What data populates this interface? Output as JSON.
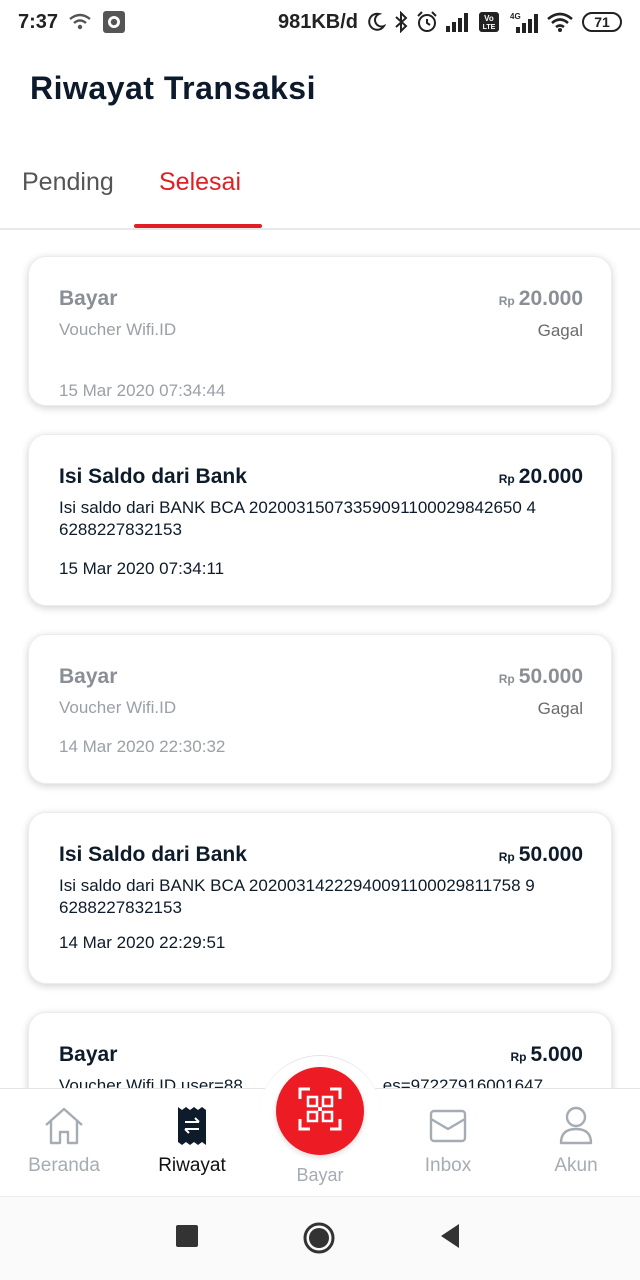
{
  "status_bar": {
    "time": "7:37",
    "network_speed": "981KB/d",
    "battery": "71",
    "volte": "Vo LTE",
    "signal_label": "4G"
  },
  "header": {
    "title": "Riwayat Transaksi"
  },
  "tabs": [
    {
      "label": "Pending",
      "active": false
    },
    {
      "label": "Selesai",
      "active": true
    }
  ],
  "transactions": [
    {
      "title": "Bayar",
      "currency": "Rp",
      "amount": "20.000",
      "description": "Voucher Wifi.ID",
      "status": "Gagal",
      "date": "15 Mar 2020 07:34:44"
    },
    {
      "title": "Isi Saldo dari Bank",
      "currency": "Rp",
      "amount": "20.000",
      "description": "Isi saldo dari BANK BCA 20200315073359091100029842650 4 6288227832153",
      "status": "",
      "date": "15 Mar 2020 07:34:11"
    },
    {
      "title": "Bayar",
      "currency": "Rp",
      "amount": "50.000",
      "description": "Voucher Wifi.ID",
      "status": "Gagal",
      "date": "14 Mar 2020 22:30:32"
    },
    {
      "title": "Isi Saldo dari Bank",
      "currency": "Rp",
      "amount": "50.000",
      "description": "Isi saldo dari BANK BCA 20200314222940091100029811758 9 6288227832153",
      "status": "",
      "date": "14 Mar 2020 22:29:51"
    },
    {
      "title": "Bayar",
      "currency": "Rp",
      "amount": "5.000",
      "description": "Voucher Wifi.ID user=88",
      "description_tail": "es=97227916001647",
      "status": "",
      "date": ""
    }
  ],
  "bottom_nav": {
    "items": [
      {
        "label": "Beranda",
        "icon": "home-icon"
      },
      {
        "label": "Riwayat",
        "icon": "receipt-icon"
      },
      {
        "label": "Bayar",
        "icon": "qr-scan-icon"
      },
      {
        "label": "Inbox",
        "icon": "mail-icon"
      },
      {
        "label": "Akun",
        "icon": "user-icon"
      }
    ]
  },
  "colors": {
    "accent": "#e01e24",
    "bayar_button": "#ed1c24",
    "text_dark": "#0d1b2a",
    "text_muted": "#9aa0a6",
    "nav_inactive": "#a5acb3"
  }
}
